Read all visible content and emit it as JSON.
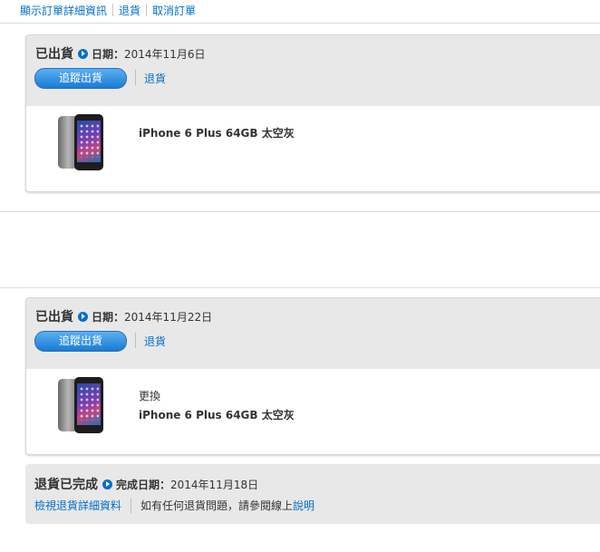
{
  "top_links": [
    "顯示訂單詳細資訊",
    "退貨",
    "取消訂單"
  ],
  "shipment1": {
    "status": "已出貨",
    "date_label": "日期：",
    "date_value": "2014年11月6日",
    "track_button": "追蹤出貨",
    "return_link": "退貨",
    "product_note": "",
    "product_name": "iPhone 6 Plus 64GB 太空灰"
  },
  "shipment2": {
    "status": "已出貨",
    "date_label": "日期：",
    "date_value": "2014年11月22日",
    "track_button": "追蹤出貨",
    "return_link": "退貨",
    "product_note": "更換",
    "product_name": "iPhone 6 Plus 64GB 太空灰"
  },
  "return_section": {
    "status": "退貨已完成",
    "date_label": "完成日期：",
    "date_value": "2014年11月18日",
    "details_link": "檢視退貨詳細資料",
    "help_text": "如有任何退貨問題，請參閱線上",
    "help_link": "說明"
  },
  "colors": {
    "link": "#0070c9",
    "header_bg": "#e8e8e8",
    "button": "#1a7bd3"
  }
}
